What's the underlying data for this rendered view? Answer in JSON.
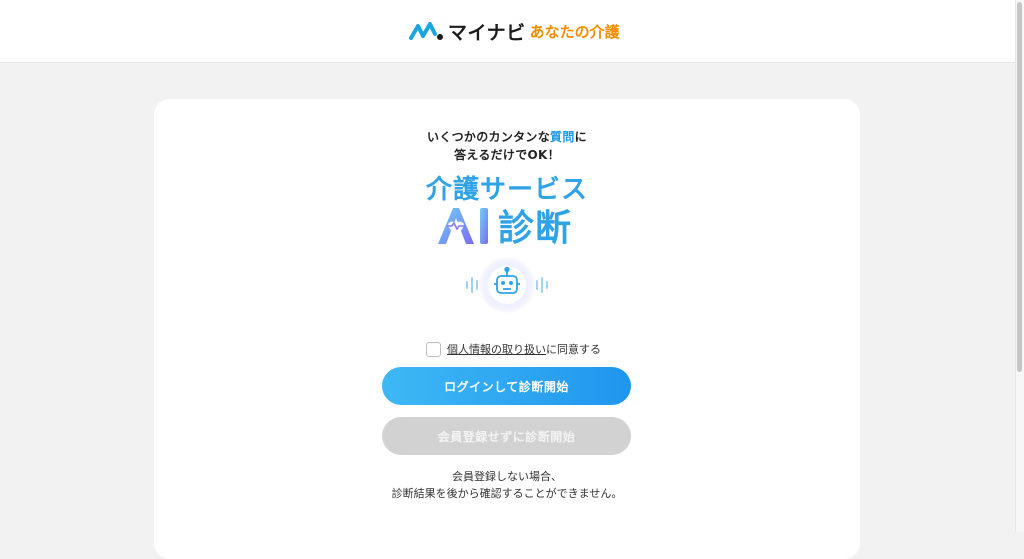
{
  "header": {
    "logo_icon": "mynavi-m-logo-icon",
    "brand": "マイナビ",
    "subbrand": "あなたの介護",
    "brand_color": "#1b1b1b",
    "subbrand_color": "#f28c00"
  },
  "card": {
    "intro_line1_pre": "いくつかのカンタンな",
    "intro_line1_hl": "質問",
    "intro_line1_post": "に",
    "intro_line2": "答えるだけでOK！",
    "title_line1": "介護サービス",
    "title_ai_text": "AI",
    "title_line2": "診断",
    "robot_icon": "robot-icon",
    "consent": {
      "link_text": "個人情報の取り扱い",
      "suffix": "に同意する",
      "checked": false
    },
    "login_button": "ログインして診断開始",
    "guest_button": "会員登録せずに診断開始",
    "note_line1": "会員登録しない場合、",
    "note_line2": "診断結果を後から確認することができません。"
  },
  "colors": {
    "accent": "#2fa3e6",
    "button_start": "#3fb8f5",
    "button_end": "#1f96ee",
    "disabled_button": "#d2d2d2",
    "page_bg": "#f2f2f2"
  }
}
